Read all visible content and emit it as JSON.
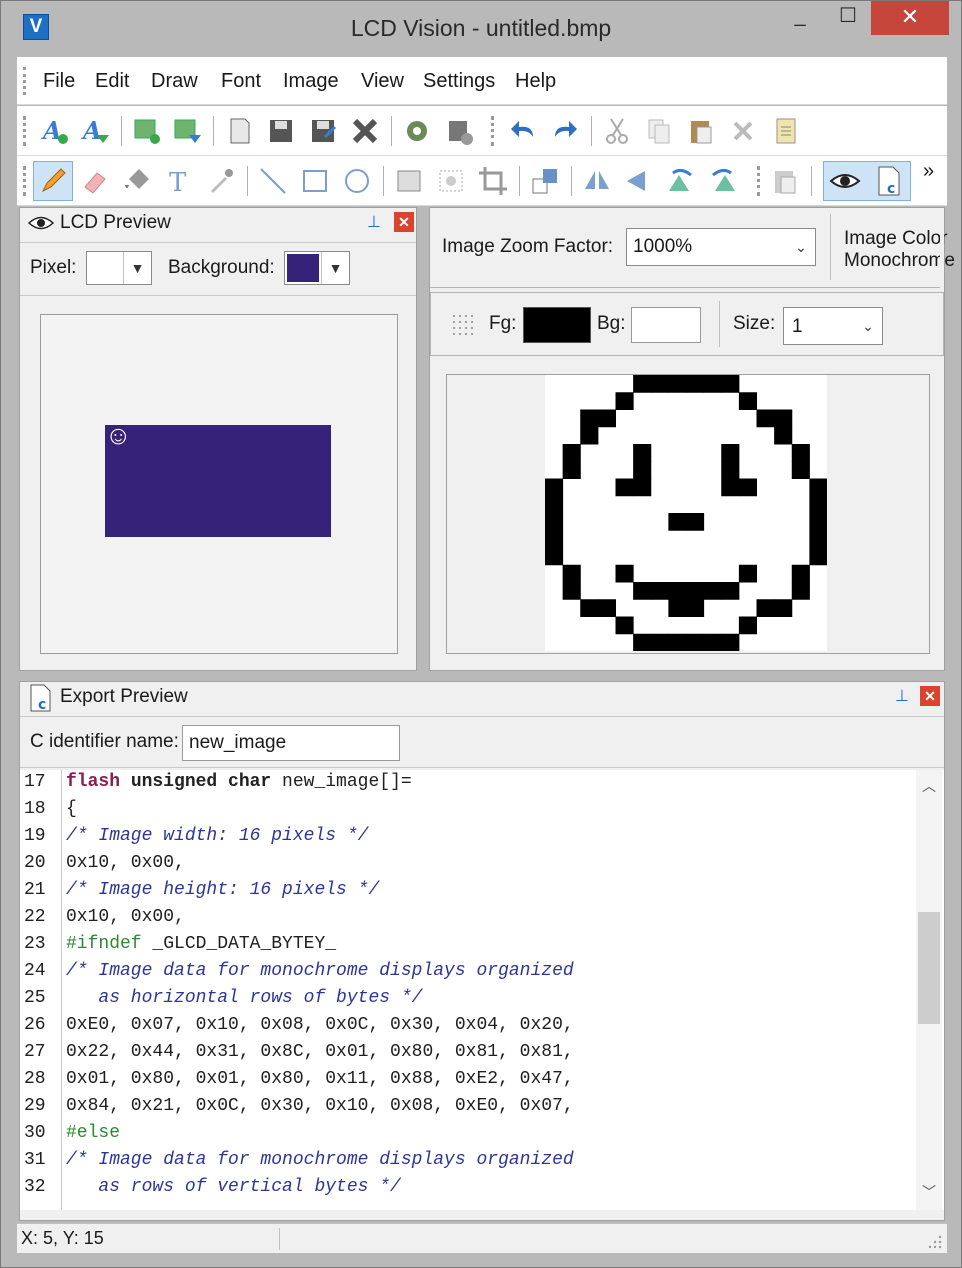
{
  "window": {
    "title": "LCD Vision - untitled.bmp",
    "app_icon_letter": "V",
    "minimize": "_",
    "maximize": "☐",
    "close": "✕"
  },
  "menu": [
    "File",
    "Edit",
    "Draw",
    "Font",
    "Image",
    "View",
    "Settings",
    "Help"
  ],
  "toolbar1": {
    "icons": [
      "new-font-icon",
      "open-font-icon",
      "new-image-icon",
      "import-image-icon",
      "open-icon",
      "save-icon",
      "save-as-icon",
      "close-doc-icon",
      "settings-gear-icon",
      "export-icon",
      "undo-icon",
      "redo-icon",
      "cut-icon",
      "copy-icon",
      "paste-icon",
      "delete-icon",
      "properties-icon"
    ]
  },
  "toolbar2": {
    "icons": [
      "pencil-icon",
      "eraser-icon",
      "fill-bucket-icon",
      "text-tool-icon",
      "color-picker-icon",
      "line-tool-icon",
      "rectangle-tool-icon",
      "ellipse-tool-icon",
      "select-rect-icon",
      "move-selection-icon",
      "crop-icon",
      "resize-icon",
      "flip-horizontal-icon",
      "flip-left-icon",
      "rotate-left-icon",
      "rotate-right-icon",
      "clipboard-icon",
      "preview-eye-icon",
      "c-export-icon"
    ],
    "overflow": "»"
  },
  "lcd_preview": {
    "title": "LCD Preview",
    "pixel_label": "Pixel:",
    "background_label": "Background:",
    "pixel_color": "#ffffff",
    "background_color": "#35237a",
    "smiley_glyph": "☺"
  },
  "image_editor": {
    "zoom_label": "Image Zoom Factor:",
    "zoom_value": "1000%",
    "image_color_label": "Image Color",
    "image_color_value": "Monochrome",
    "fg_label": "Fg:",
    "bg_label": "Bg:",
    "fg_color": "#000000",
    "bg_color": "#ffffff",
    "size_label": "Size:",
    "size_value": "1",
    "bitmap_rows": [
      "0000011111100000",
      "0000100000010000",
      "0011000000001100",
      "0010000000000100",
      "0100010000100010",
      "0100010000100010",
      "1000110000110001",
      "1000000000000001",
      "1000000110000001",
      "1000000000000001",
      "1000000000000001",
      "0100100000010010",
      "0100011111100010",
      "0011000110001100",
      "0000100000010000",
      "0000011111100000"
    ]
  },
  "export_preview": {
    "title": "Export Preview",
    "identifier_label": "C identifier name:",
    "identifier_value": "new_image",
    "lines": [
      {
        "n": "17",
        "parts": [
          [
            "kw",
            "flash "
          ],
          [
            "kw2",
            "unsigned char "
          ],
          [
            "plain",
            "new_image[]="
          ]
        ]
      },
      {
        "n": "18",
        "parts": [
          [
            "plain",
            "{"
          ]
        ]
      },
      {
        "n": "19",
        "parts": [
          [
            "cmt",
            "/* Image width: 16 pixels */"
          ]
        ]
      },
      {
        "n": "20",
        "parts": [
          [
            "plain",
            "0x10, 0x00,"
          ]
        ]
      },
      {
        "n": "21",
        "parts": [
          [
            "cmt",
            "/* Image height: 16 pixels */"
          ]
        ]
      },
      {
        "n": "22",
        "parts": [
          [
            "plain",
            "0x10, 0x00,"
          ]
        ]
      },
      {
        "n": "23",
        "parts": [
          [
            "pp",
            "#ifndef "
          ],
          [
            "plain",
            "_GLCD_DATA_BYTEY_"
          ]
        ]
      },
      {
        "n": "24",
        "parts": [
          [
            "cmt",
            "/* Image data for monochrome displays organized"
          ]
        ]
      },
      {
        "n": "25",
        "parts": [
          [
            "cmt",
            "   as horizontal rows of bytes */"
          ]
        ]
      },
      {
        "n": "26",
        "parts": [
          [
            "plain",
            "0xE0, 0x07, 0x10, 0x08, 0x0C, 0x30, 0x04, 0x20,"
          ]
        ]
      },
      {
        "n": "27",
        "parts": [
          [
            "plain",
            "0x22, 0x44, 0x31, 0x8C, 0x01, 0x80, 0x81, 0x81,"
          ]
        ]
      },
      {
        "n": "28",
        "parts": [
          [
            "plain",
            "0x01, 0x80, 0x01, 0x80, 0x11, 0x88, 0xE2, 0x47,"
          ]
        ]
      },
      {
        "n": "29",
        "parts": [
          [
            "plain",
            "0x84, 0x21, 0x0C, 0x30, 0x10, 0x08, 0xE0, 0x07,"
          ]
        ]
      },
      {
        "n": "30",
        "parts": [
          [
            "pp",
            "#else"
          ]
        ]
      },
      {
        "n": "31",
        "parts": [
          [
            "cmt",
            "/* Image data for monochrome displays organized"
          ]
        ]
      },
      {
        "n": "32",
        "parts": [
          [
            "cmt",
            "   as rows of vertical bytes */"
          ]
        ]
      }
    ]
  },
  "status": {
    "text": "X: 5, Y: 15"
  }
}
